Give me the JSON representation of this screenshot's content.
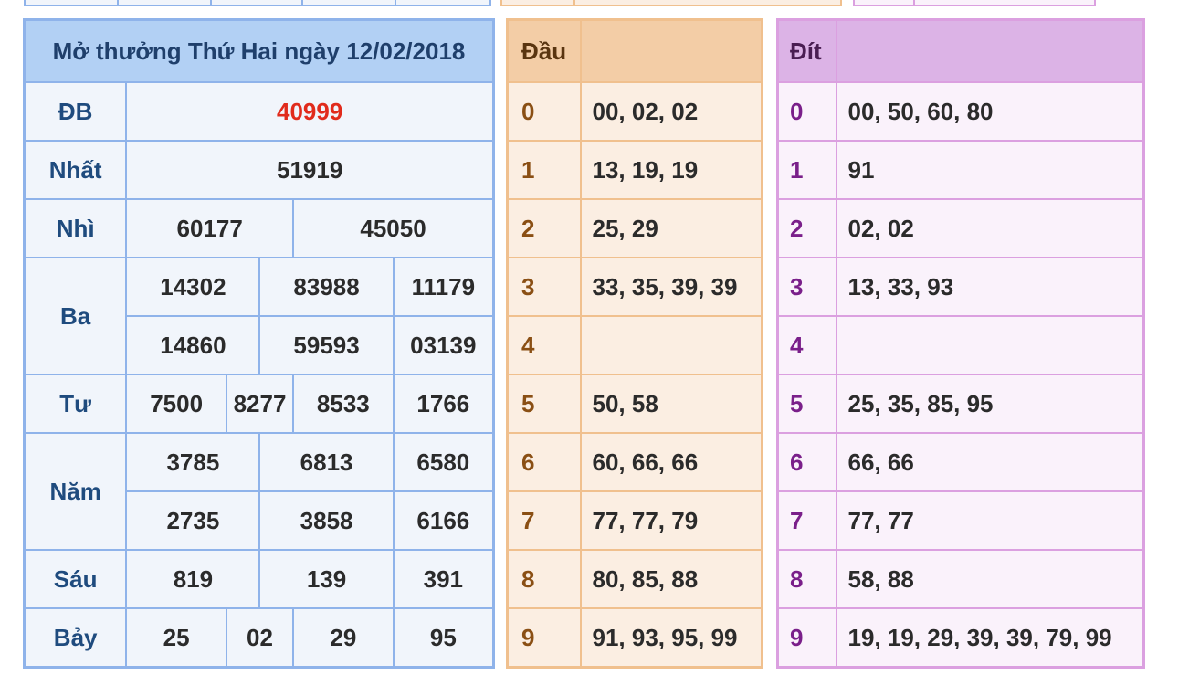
{
  "results": {
    "title": "Mở thưởng Thứ Hai ngày 12/02/2018",
    "rows": {
      "db": {
        "label": "ĐB",
        "values": [
          "40999"
        ]
      },
      "nhat": {
        "label": "Nhất",
        "values": [
          "51919"
        ]
      },
      "nhi": {
        "label": "Nhì",
        "values": [
          "60177",
          "45050"
        ]
      },
      "ba": {
        "label": "Ba",
        "values": [
          "14302",
          "83988",
          "11179",
          "14860",
          "59593",
          "03139"
        ]
      },
      "tu": {
        "label": "Tư",
        "values": [
          "7500",
          "8277",
          "8533",
          "1766"
        ]
      },
      "nam": {
        "label": "Năm",
        "values": [
          "3785",
          "6813",
          "6580",
          "2735",
          "3858",
          "6166"
        ]
      },
      "sau": {
        "label": "Sáu",
        "values": [
          "819",
          "139",
          "391"
        ]
      },
      "bay": {
        "label": "Bảy",
        "values": [
          "25",
          "02",
          "29",
          "95"
        ]
      }
    }
  },
  "dau": {
    "header": "Đầu",
    "rows": [
      {
        "key": "0",
        "values": "00, 02, 02"
      },
      {
        "key": "1",
        "values": "13, 19, 19"
      },
      {
        "key": "2",
        "values": "25, 29"
      },
      {
        "key": "3",
        "values": "33, 35, 39, 39"
      },
      {
        "key": "4",
        "values": ""
      },
      {
        "key": "5",
        "values": "50, 58"
      },
      {
        "key": "6",
        "values": "60, 66, 66"
      },
      {
        "key": "7",
        "values": "77, 77, 79"
      },
      {
        "key": "8",
        "values": "80, 85, 88"
      },
      {
        "key": "9",
        "values": "91, 93, 95, 99"
      }
    ]
  },
  "dit": {
    "header": "Đít",
    "rows": [
      {
        "key": "0",
        "values": "00, 50, 60, 80"
      },
      {
        "key": "1",
        "values": "91"
      },
      {
        "key": "2",
        "values": "02, 02"
      },
      {
        "key": "3",
        "values": "13, 33, 93"
      },
      {
        "key": "4",
        "values": ""
      },
      {
        "key": "5",
        "values": "25, 35, 85, 95"
      },
      {
        "key": "6",
        "values": "66, 66"
      },
      {
        "key": "7",
        "values": "77, 77"
      },
      {
        "key": "8",
        "values": "58, 88"
      },
      {
        "key": "9",
        "values": "19, 19, 29, 39, 39, 79, 99"
      }
    ]
  },
  "colors": {
    "blue_border": "#8fb3ea",
    "blue_header": "#b2d0f4",
    "orange_border": "#f0c08e",
    "orange_header": "#f3cda6",
    "purple_border": "#dba0e0",
    "purple_header": "#dcb3e6",
    "special_prize": "#e12b1c"
  }
}
